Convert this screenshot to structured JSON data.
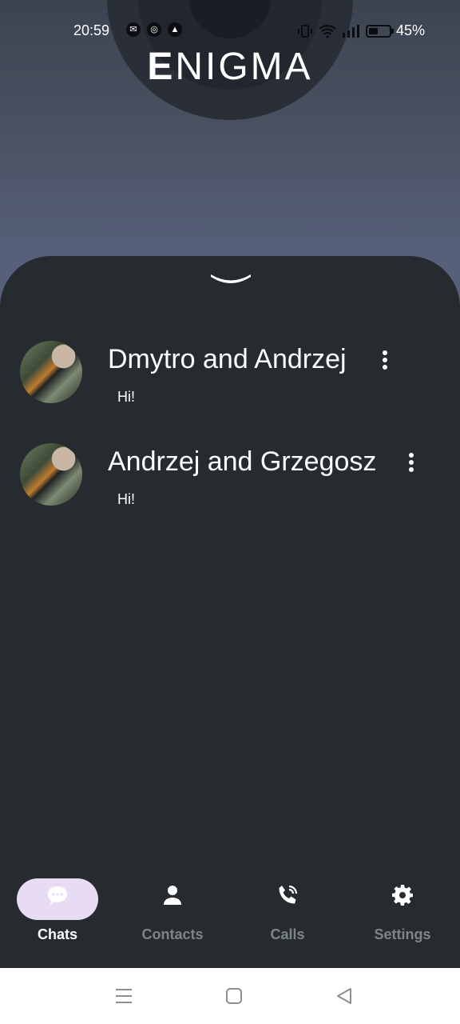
{
  "status_bar": {
    "time": "20:59",
    "battery_percent": "45%",
    "battery_level": 0.45,
    "notification_icons": [
      "messenger-icon",
      "instagram-icon",
      "app-icon"
    ]
  },
  "header": {
    "logo_first": "E",
    "logo_rest": "NIGMA"
  },
  "chats": [
    {
      "name": "Dmytro and Andrzej",
      "last_message": "Hi!"
    },
    {
      "name": "Andrzej and Grzegosz",
      "last_message": "Hi!"
    }
  ],
  "bottom_nav": [
    {
      "label": "Chats",
      "icon": "chat-bubble-icon",
      "active": true
    },
    {
      "label": "Contacts",
      "icon": "person-icon",
      "active": false
    },
    {
      "label": "Calls",
      "icon": "phone-icon",
      "active": false
    },
    {
      "label": "Settings",
      "icon": "gear-icon",
      "active": false
    }
  ],
  "colors": {
    "sheet_background": "#252b2e",
    "active_pill": "#e7dcf3",
    "inactive_label": "#7d858c"
  }
}
